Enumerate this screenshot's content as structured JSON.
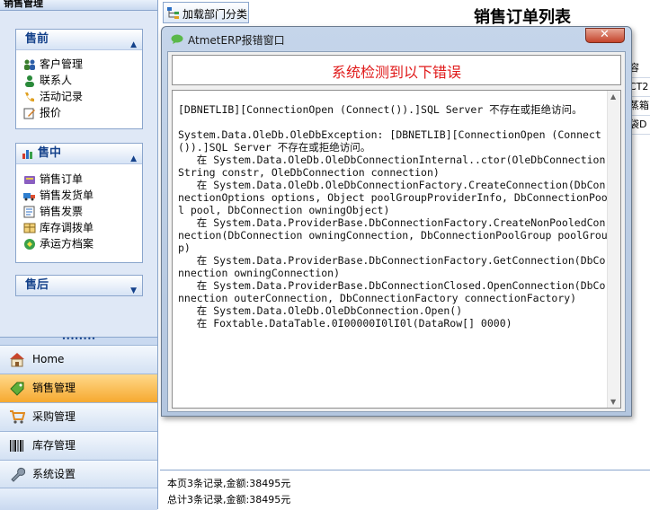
{
  "sidebar": {
    "title": "销售管理",
    "groups": [
      {
        "title": "售前",
        "items": [
          {
            "label": "客户管理",
            "icon": "customers-icon"
          },
          {
            "label": "联系人",
            "icon": "contact-person-icon"
          },
          {
            "label": "活动记录",
            "icon": "activity-phone-icon"
          },
          {
            "label": "报价",
            "icon": "quote-edit-icon"
          }
        ]
      },
      {
        "title": "售中",
        "icon": "bar-chart-icon",
        "items": [
          {
            "label": "销售订单",
            "icon": "sales-order-icon"
          },
          {
            "label": "销售发货单",
            "icon": "delivery-truck-icon"
          },
          {
            "label": "销售发票",
            "icon": "invoice-icon"
          },
          {
            "label": "库存调拨单",
            "icon": "stock-transfer-icon"
          },
          {
            "label": "承运方档案",
            "icon": "carrier-icon"
          }
        ]
      },
      {
        "title": "售后",
        "items": []
      }
    ],
    "grip": "••••••••",
    "nav": [
      {
        "label": "Home",
        "icon": "home-icon"
      },
      {
        "label": "销售管理",
        "icon": "sales-tag-icon",
        "active": true
      },
      {
        "label": "采购管理",
        "icon": "shopping-cart-icon"
      },
      {
        "label": "库存管理",
        "icon": "barcode-icon"
      },
      {
        "label": "系统设置",
        "icon": "wrench-icon"
      }
    ]
  },
  "toolbar": {
    "load_category_label": "加载部门分类"
  },
  "page": {
    "title": "销售订单列表"
  },
  "grid_peek": [
    "容",
    "CT2",
    "蒸箱",
    "袋D"
  ],
  "status": {
    "page_summary": "本页3条记录,金额:38495元",
    "total_summary": "总计3条记录,金额:38495元"
  },
  "dialog": {
    "title": "AtmetERP报错窗口",
    "close_glyph": "✕",
    "headline": "系统检测到以下错误",
    "error_text": "[DBNETLIB][ConnectionOpen (Connect()).]SQL Server 不存在或拒绝访问。\n\nSystem.Data.OleDb.OleDbException: [DBNETLIB][ConnectionOpen (Connect()).]SQL Server 不存在或拒绝访问。\n   在 System.Data.OleDb.OleDbConnectionInternal..ctor(OleDbConnectionString constr, OleDbConnection connection)\n   在 System.Data.OleDb.OleDbConnectionFactory.CreateConnection(DbConnectionOptions options, Object poolGroupProviderInfo, DbConnectionPool pool, DbConnection owningObject)\n   在 System.Data.ProviderBase.DbConnectionFactory.CreateNonPooledConnection(DbConnection owningConnection, DbConnectionPoolGroup poolGroup)\n   在 System.Data.ProviderBase.DbConnectionFactory.GetConnection(DbConnection owningConnection)\n   在 System.Data.ProviderBase.DbConnectionClosed.OpenConnection(DbConnection outerConnection, DbConnectionFactory connectionFactory)\n   在 System.Data.OleDb.OleDbConnection.Open()\n   在 Foxtable.DataTable.0I00000I0lI0l(DataRow[] 0000)"
  },
  "colors": {
    "accent": "#15428b",
    "active_nav": "#f6a930",
    "error_headline": "#e01a1a",
    "close_button": "#c4432b"
  }
}
